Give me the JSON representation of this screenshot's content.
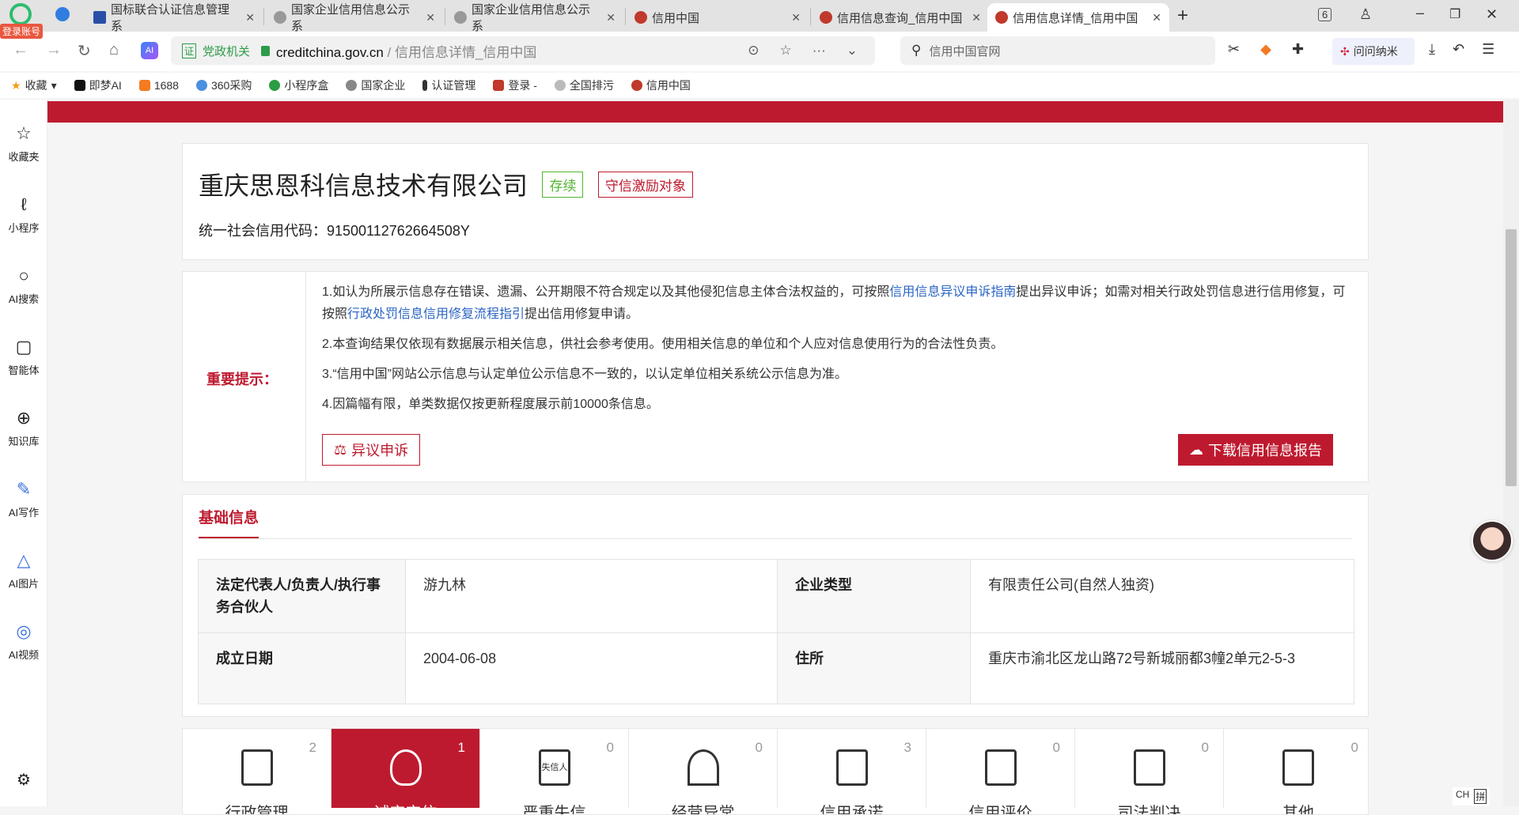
{
  "browser": {
    "login_badge": "登录账号",
    "tabs": [
      {
        "title": "国标联合认证信息管理系",
        "favicon": "cert-icon"
      },
      {
        "title": "国家企业信用信息公示系",
        "favicon": "globe-icon"
      },
      {
        "title": "国家企业信用信息公示系",
        "favicon": "globe-icon"
      },
      {
        "title": "信用中国",
        "favicon": "emblem-icon"
      },
      {
        "title": "信用信息查询_信用中国",
        "favicon": "emblem-icon"
      },
      {
        "title": "信用信息详情_信用中国",
        "favicon": "emblem-icon",
        "active": true
      }
    ],
    "tab_count": "6",
    "address": {
      "badge": "证",
      "org": "党政机关",
      "domain": "creditchina.gov.cn",
      "path": " / 信用信息详情_信用中国"
    },
    "search_placeholder": "信用中国官网",
    "ai_button": "问问纳米",
    "bookmarks": [
      "收藏",
      "即梦AI",
      "1688",
      "360采购",
      "小程序盒",
      "国家企业",
      "认证管理",
      "登录 -",
      "全国排污",
      "信用中国"
    ]
  },
  "sidebar": [
    {
      "label": "收藏夹",
      "icon": "☆"
    },
    {
      "label": "小程序",
      "icon": "ℓ"
    },
    {
      "label": "AI搜索",
      "icon": "○"
    },
    {
      "label": "智能体",
      "icon": "▢"
    },
    {
      "label": "知识库",
      "icon": "⊕"
    },
    {
      "label": "AI写作",
      "icon": "✎"
    },
    {
      "label": "AI图片",
      "icon": "△"
    },
    {
      "label": "AI视频",
      "icon": "◎"
    }
  ],
  "company": {
    "name": "重庆思恩科信息技术有限公司",
    "status": "存续",
    "tag": "守信激励对象",
    "code_label": "统一社会信用代码：",
    "code": "91500112762664508Y"
  },
  "notice": {
    "title": "重要提示：",
    "p1a": "1.如认为所展示信息存在错误、遗漏、公开期限不符合规定以及其他侵犯信息主体合法权益的，可按照",
    "p1link1": "信用信息异议申诉指南",
    "p1b": "提出异议申诉；如需对相关行政处罚信息进行信用修复，可按照",
    "p1link2": "行政处罚信息信用修复流程指引",
    "p1c": "提出信用修复申请。",
    "p2": "2.本查询结果仅依现有数据展示相关信息，供社会参考使用。使用相关信息的单位和个人应对信息使用行为的合法性负责。",
    "p3": "3.“信用中国”网站公示信息与认定单位公示信息不一致的，以认定单位相关系统公示信息为准。",
    "p4": "4.因篇幅有限，单类数据仅按更新程度展示前10000条信息。",
    "objection_btn": "异议申诉",
    "download_btn": "下载信用信息报告"
  },
  "basic": {
    "tab": "基础信息",
    "rows": [
      {
        "k1": "法定代表人/负责人/执行事务合伙人",
        "v1": "游九林",
        "k2": "企业类型",
        "v2": "有限责任公司(自然人独资)"
      },
      {
        "k1": "成立日期",
        "v1": "2004-06-08",
        "k2": "住所",
        "v2": "重庆市渝北区龙山路72号新城丽都3幢2单元2-5-3"
      }
    ]
  },
  "categories": [
    {
      "label": "行政管理",
      "count": "2"
    },
    {
      "label": "诚实守信",
      "count": "1",
      "active": true
    },
    {
      "label": "严重失信",
      "count": "0",
      "icon_text": "失信人"
    },
    {
      "label": "经营异常",
      "count": "0"
    },
    {
      "label": "信用承诺",
      "count": "3"
    },
    {
      "label": "信用评价",
      "count": "0"
    },
    {
      "label": "司法判决",
      "count": "0"
    },
    {
      "label": "其他",
      "count": "0"
    }
  ],
  "tray": {
    "ime": "CH",
    "mode": "拼"
  },
  "colors": {
    "brand_red": "#be1a2f",
    "status_green": "#52b52f",
    "link": "#2b65c3"
  }
}
